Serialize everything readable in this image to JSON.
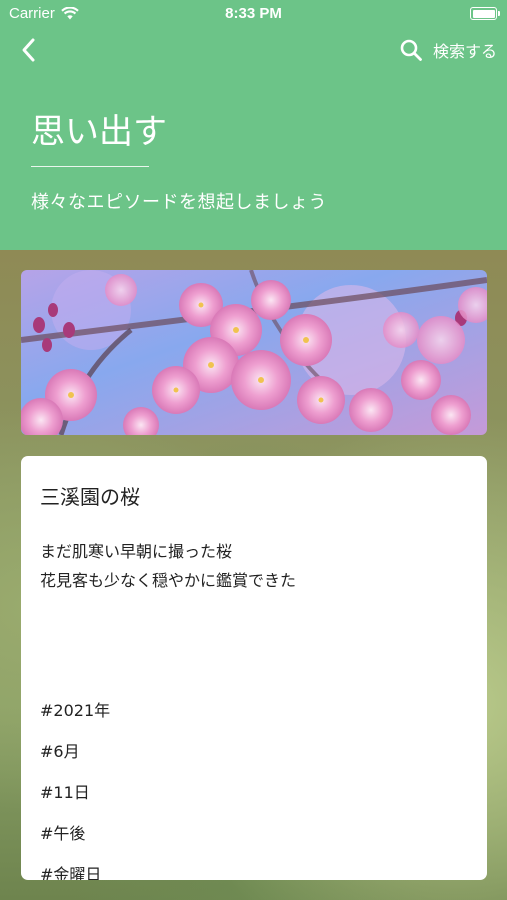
{
  "status_bar": {
    "carrier": "Carrier",
    "time": "8:33 PM"
  },
  "nav": {
    "search_label": "検索する"
  },
  "header": {
    "title": "思い出す",
    "subtitle": "様々なエピソードを想起しましょう"
  },
  "entry": {
    "title": "三溪園の桜",
    "body_lines": [
      "まだ肌寒い早朝に撮った桜",
      "花見客も少なく穏やかに鑑賞できた"
    ],
    "tags": [
      "#2021年",
      "#6月",
      "#11日",
      "#午後",
      "#金曜日"
    ]
  },
  "colors": {
    "header_green": "#6cc488",
    "card_bg": "#ffffff",
    "text_dark": "#222222"
  },
  "icons": {
    "back": "chevron-left-icon",
    "search": "magnifier-icon",
    "wifi": "wifi-icon",
    "battery": "battery-icon"
  }
}
